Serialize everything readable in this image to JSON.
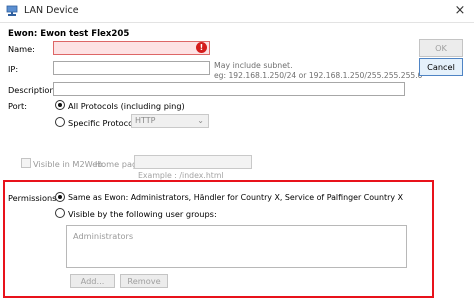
{
  "window": {
    "title": "LAN Device",
    "close_glyph": "×",
    "app_icon": "network-icon"
  },
  "device_heading": "Ewon: Ewon test Flex205",
  "form": {
    "name_label": "Name:",
    "name_value": "",
    "ip_label": "IP:",
    "ip_value": "",
    "ip_hint_line1": "May include subnet.",
    "ip_hint_line2": "eg: 192.168.1.250/24 or 192.168.1.250/255.255.255.0",
    "description_label": "Description:",
    "description_value": "",
    "port_label": "Port:",
    "port_all": "All Protocols (including ping)",
    "port_specific": "Specific Protocol:",
    "port_specific_value": "HTTP",
    "visible_m2web": "Visible in M2Web.",
    "home_page_label": "Home page:",
    "home_page_value": "",
    "home_page_example": "Example : /index.html"
  },
  "buttons": {
    "ok": "OK",
    "cancel": "Cancel",
    "add": "Add...",
    "remove": "Remove"
  },
  "permissions": {
    "label": "Permissions:",
    "same_as_ewon": "Same as Ewon: Administrators, Händler for Country X, Service of Palfinger Country X",
    "visible_groups": "Visible by the following user groups:",
    "groups": [
      "Administrators"
    ],
    "selected": "same_as_ewon"
  },
  "colors": {
    "highlight_border": "#e8121b",
    "error_fill": "#fde2e4",
    "error_badge": "#d41c1c"
  }
}
